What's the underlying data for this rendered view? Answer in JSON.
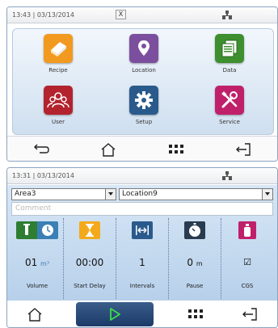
{
  "home": {
    "statusbar": {
      "time": "13:43 | 03/13/2014",
      "close_label": "X"
    },
    "tiles": [
      {
        "label": "Recipe",
        "icon": "book-icon",
        "color": "#f29a1f"
      },
      {
        "label": "Location",
        "icon": "map-pin-icon",
        "color": "#7b4f9e"
      },
      {
        "label": "Data",
        "icon": "documents-icon",
        "color": "#3e8f2f"
      },
      {
        "label": "User",
        "icon": "users-icon",
        "color": "#b3232e"
      },
      {
        "label": "Setup",
        "icon": "gear-icon",
        "color": "#2a5a8c"
      },
      {
        "label": "Service",
        "icon": "tools-icon",
        "color": "#c0206a"
      }
    ],
    "bottombar": [
      "back-arrow-icon",
      "home-icon",
      "grid-menu-icon",
      "logout-icon"
    ]
  },
  "measure": {
    "statusbar": {
      "time": "13:31 | 03/13/2014"
    },
    "area_select": "Area3",
    "location_select": "Location9",
    "comment_placeholder": "Comment",
    "params": [
      {
        "label": "Volume",
        "value": "01",
        "unit": "m³",
        "icon": "volume-timer-icon",
        "color": "#2e7d32"
      },
      {
        "label": "Start Delay",
        "value": "00:00",
        "unit": "",
        "icon": "hourglass-icon",
        "color": "#f4a91c"
      },
      {
        "label": "Intervals",
        "value": "1",
        "unit": "",
        "icon": "intervals-icon",
        "color": "#2a5a8c"
      },
      {
        "label": "Pause",
        "value": "0",
        "unit": "m",
        "icon": "stopwatch-icon",
        "color": "#2a3b50"
      },
      {
        "label": "CGS",
        "value": "☑",
        "unit": "",
        "icon": "bottle-icon",
        "color": "#c0206a"
      }
    ],
    "colors": {
      "accent": "#1f3d6b",
      "play": "#3ddc4b"
    }
  }
}
